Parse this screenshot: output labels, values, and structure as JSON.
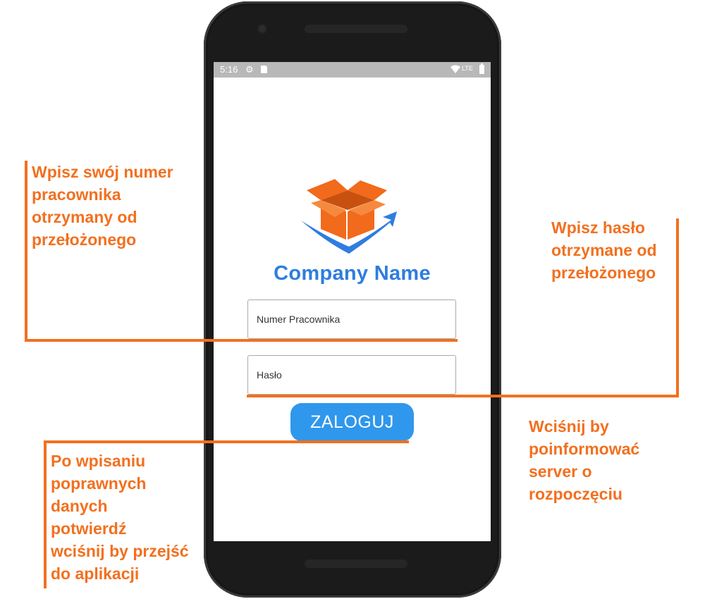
{
  "status_bar": {
    "time": "5:16",
    "network": "LTE"
  },
  "app": {
    "company_name": "Company Name",
    "logo_colors": {
      "box": "#f26a1b",
      "arrow": "#2e7de0"
    }
  },
  "form": {
    "employee_number": {
      "placeholder": "Numer Pracownika",
      "value": ""
    },
    "password": {
      "placeholder": "Hasło",
      "value": ""
    },
    "login_button": "ZALOGUJ"
  },
  "annotations": {
    "employee_number": [
      "Wpisz swój numer",
      "pracownika",
      "otrzymany od",
      "przełożonego"
    ],
    "password": [
      "Wpisz hasło",
      "otrzymane od",
      "przełożonego"
    ],
    "login": [
      "Po wpisaniu",
      "poprawnych",
      "danych",
      "potwierdź",
      "wciśnij by przejść",
      "do aplikacji"
    ],
    "server": [
      "Wciśnij by",
      "poinformować",
      "server o",
      "rozpoczęciu"
    ]
  },
  "accent_color": "#f2701f",
  "button_color": "#2f97ec"
}
